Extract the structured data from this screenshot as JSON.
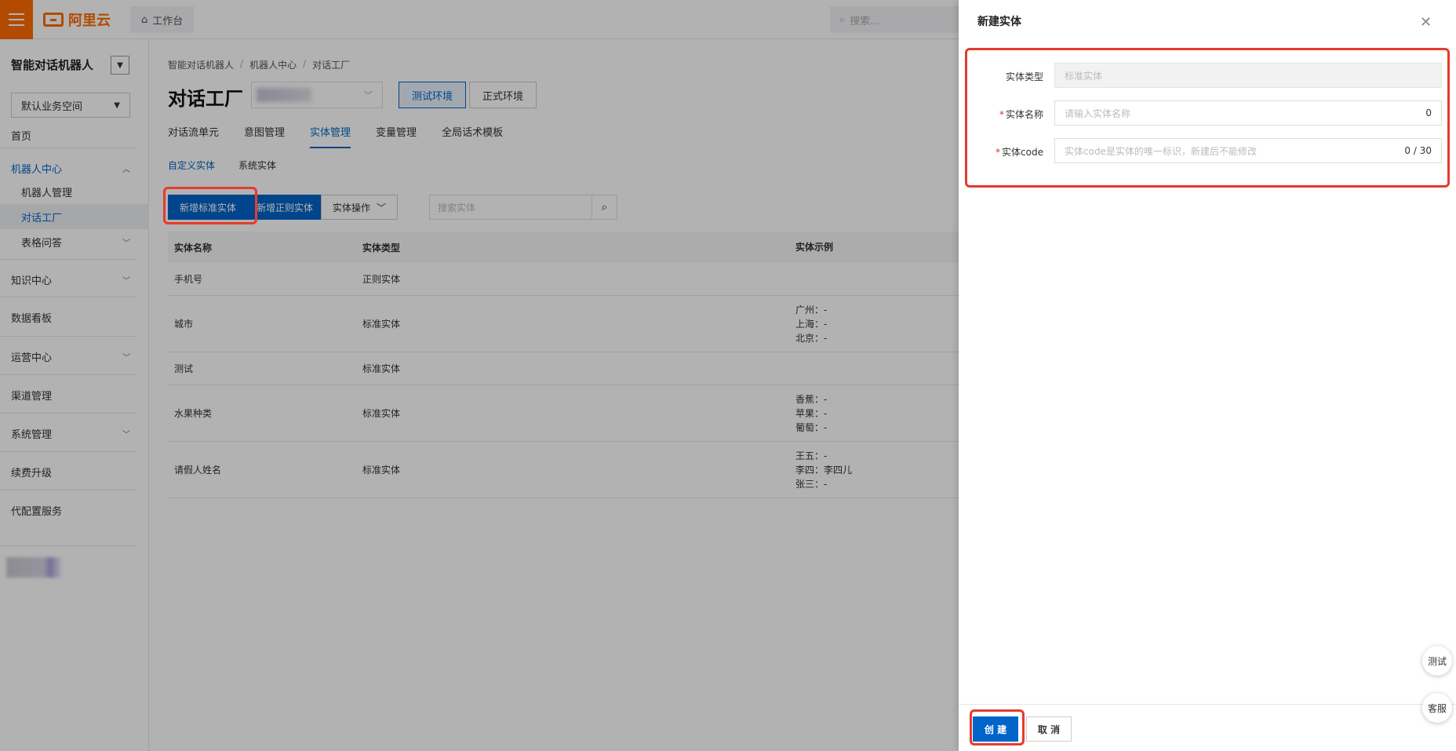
{
  "topbar": {
    "logo_text": "阿里云",
    "workbench": "工作台",
    "search_placeholder": "搜索..."
  },
  "sidebar": {
    "title": "智能对话机器人",
    "workspace": "默认业务空间",
    "items": [
      {
        "label": "首页"
      },
      {
        "label": "机器人中心"
      },
      {
        "label": "机器人管理"
      },
      {
        "label": "对话工厂"
      },
      {
        "label": "表格问答"
      },
      {
        "label": "知识中心"
      },
      {
        "label": "数据看板"
      },
      {
        "label": "运营中心"
      },
      {
        "label": "渠道管理"
      },
      {
        "label": "系统管理"
      },
      {
        "label": "续费升级"
      },
      {
        "label": "代配置服务"
      }
    ]
  },
  "main": {
    "breadcrumb": [
      "智能对话机器人",
      "/",
      "机器人中心",
      "/",
      "对话工厂"
    ],
    "title": "对话工厂",
    "env_test": "测试环境",
    "env_prod": "正式环境",
    "tabs": [
      "对话流单元",
      "意图管理",
      "实体管理",
      "变量管理",
      "全局话术模板"
    ],
    "subtabs": [
      "自定义实体",
      "系统实体"
    ],
    "btn_add_standard": "新增标准实体",
    "btn_add_regex": "新增正则实体",
    "btn_entity_ops": "实体操作",
    "search_placeholder": "搜索实体",
    "table": {
      "headers": [
        "实体名称",
        "实体类型",
        "实体示例"
      ],
      "rows": [
        {
          "name": "手机号",
          "type": "正则实体",
          "ex1": "",
          "ex2": "",
          "ex3": ""
        },
        {
          "name": "城市",
          "type": "标准实体",
          "ex1": "广州：-",
          "ex2": "上海：-",
          "ex3": "北京：-"
        },
        {
          "name": "测试",
          "type": "标准实体",
          "ex1": "",
          "ex2": "",
          "ex3": ""
        },
        {
          "name": "水果种类",
          "type": "标准实体",
          "ex1": "香蕉：-",
          "ex2": "苹果：-",
          "ex3": "葡萄：-"
        },
        {
          "name": "请假人姓名",
          "type": "标准实体",
          "ex1": "王五：-",
          "ex2": "李四：李四儿",
          "ex3": "张三：-"
        }
      ]
    }
  },
  "drawer": {
    "title": "新建实体",
    "type_label": "实体类型",
    "type_value": "标准实体",
    "name_label": "实体名称",
    "name_placeholder": "请输入实体名称",
    "name_count": "0",
    "code_label": "实体code",
    "code_placeholder": "实体code是实体的唯一标识，新建后不能修改",
    "code_count": "0 / 30",
    "required_mark": "*",
    "create": "创 建",
    "cancel": "取 消"
  },
  "float": {
    "test": "测试",
    "service": "客服"
  },
  "colors": {
    "brand_orange": "#ff6a00",
    "primary_blue": "#0064c8",
    "highlight_red": "#e53b2c"
  }
}
